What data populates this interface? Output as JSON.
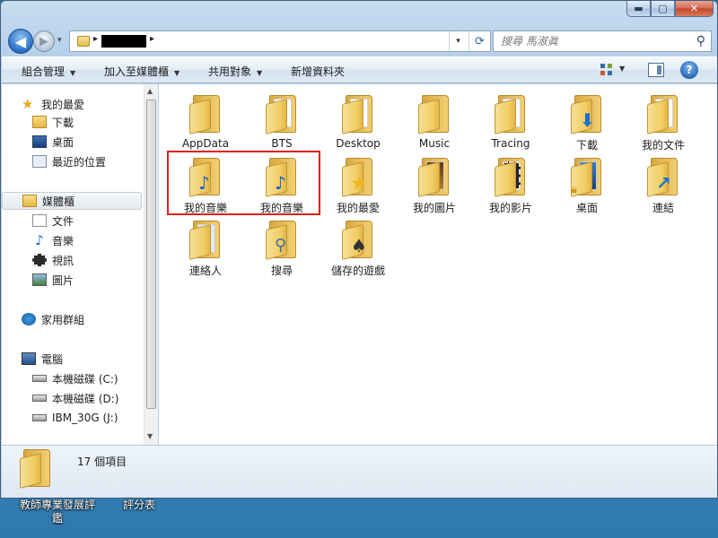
{
  "window": {
    "caption_buttons": {
      "minimize": "▬",
      "maximize": "▢",
      "close": "✕"
    }
  },
  "address": {
    "back_glyph": "◀",
    "forward_glyph": "▶",
    "dropdown_glyph": "▾",
    "separator": "▸",
    "refresh_glyph": "⟳"
  },
  "search": {
    "placeholder": "搜尋 馬淑眞"
  },
  "toolbar": {
    "organize": "組合管理",
    "include": "加入至媒體櫃",
    "share": "共用對象",
    "new_folder": "新增資料夾"
  },
  "sidebar": {
    "favorites": {
      "label": "我的最愛",
      "items": [
        "下載",
        "桌面",
        "最近的位置"
      ]
    },
    "libraries": {
      "label": "媒體櫃",
      "items": [
        "文件",
        "音樂",
        "視訊",
        "圖片"
      ]
    },
    "homegroup": {
      "label": "家用群組"
    },
    "computer": {
      "label": "電腦",
      "items": [
        "本機磁碟 (C:)",
        "本機磁碟 (D:)",
        "IBM_30G (J:)"
      ]
    }
  },
  "items": [
    {
      "label": "AppData",
      "emblem": "none"
    },
    {
      "label": "BTS",
      "emblem": "paper"
    },
    {
      "label": "Desktop",
      "emblem": "paper-red"
    },
    {
      "label": "Music",
      "emblem": "none"
    },
    {
      "label": "Tracing",
      "emblem": "paper"
    },
    {
      "label": "下載",
      "emblem": "download-arrow"
    },
    {
      "label": "我的文件",
      "emblem": "document"
    },
    {
      "label": "我的音樂",
      "emblem": "music-note"
    },
    {
      "label": "我的音樂",
      "emblem": "music-note"
    },
    {
      "label": "我的最愛",
      "emblem": "star"
    },
    {
      "label": "我的圖片",
      "emblem": "picture"
    },
    {
      "label": "我的影片",
      "emblem": "film"
    },
    {
      "label": "桌面",
      "emblem": "desktop-lock"
    },
    {
      "label": "連結",
      "emblem": "link-arrow"
    },
    {
      "label": "連絡人",
      "emblem": "contact-card"
    },
    {
      "label": "搜尋",
      "emblem": "magnifier"
    },
    {
      "label": "儲存的遊戲",
      "emblem": "chess"
    }
  ],
  "details": {
    "count": "17 個項目"
  },
  "desktop": {
    "icon1": "教師專業發展評鑑",
    "icon2": "評分表"
  }
}
